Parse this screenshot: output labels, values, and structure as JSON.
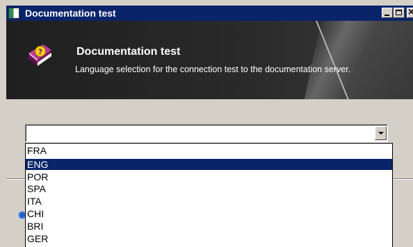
{
  "window": {
    "title": "Documentation test"
  },
  "header": {
    "title": "Documentation test",
    "description": "Language selection for the connection test to the documentation server.",
    "icon": "help-book-icon"
  },
  "language_select": {
    "value": "",
    "options": [
      "FRA",
      "ENG",
      "POR",
      "SPA",
      "ITA",
      "CHI",
      "BRI",
      "GER"
    ],
    "selected": "ENG"
  },
  "colors": {
    "titlebar": "#0a246a",
    "selection": "#0a246a",
    "banner": "#262626",
    "dialog": "#d4d0c8"
  }
}
